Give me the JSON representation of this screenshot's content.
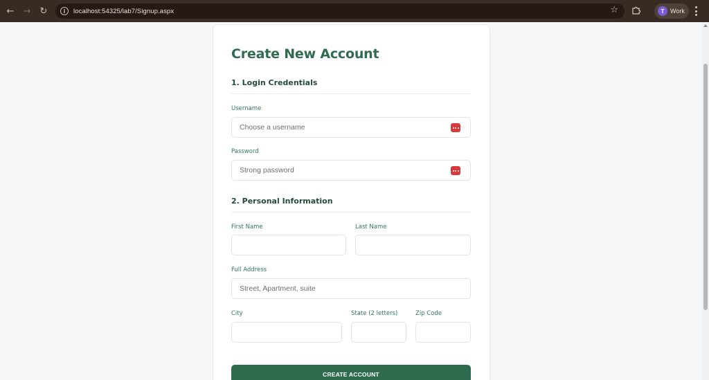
{
  "browser": {
    "url": "localhost:54325/lab7/Signup.aspx",
    "profile_initial": "T",
    "profile_label": "Work",
    "icons": {
      "back": "arrow-left-icon",
      "forward": "arrow-right-icon",
      "reload": "reload-icon",
      "info": "info-icon",
      "bookmark": "star-icon",
      "extensions": "puzzle-icon",
      "menu": "kebab-menu-icon"
    }
  },
  "form": {
    "title": "Create New Account",
    "section1": {
      "title": "1. Login Credentials",
      "username_label": "Username",
      "username_placeholder": "Choose a username",
      "password_label": "Password",
      "password_placeholder": "Strong password"
    },
    "section2": {
      "title": "2. Personal Information",
      "first_name_label": "First Name",
      "last_name_label": "Last Name",
      "address_label": "Full Address",
      "address_placeholder": "Street, Apartment, suite",
      "city_label": "City",
      "state_label": "State (2 letters)",
      "zip_label": "Zip Code"
    },
    "submit_label": "CREATE ACCOUNT"
  },
  "colors": {
    "accent": "#2f6b4e",
    "label": "#2f7a56",
    "password_manager_badge": "#d63a3a",
    "chrome_bg": "#3a2a24"
  }
}
